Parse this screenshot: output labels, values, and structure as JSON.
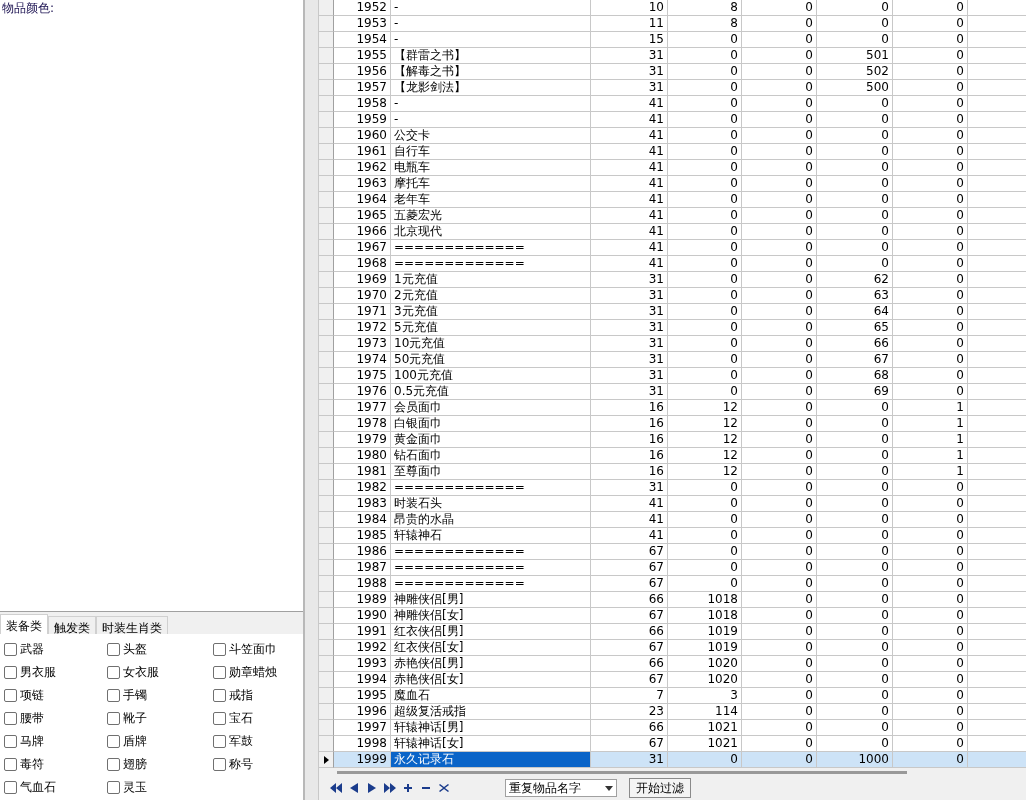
{
  "left_panel": {
    "color_label": "物品颜色:",
    "tabs": [
      {
        "label": "装备类",
        "selected": true
      },
      {
        "label": "触发类",
        "selected": false
      },
      {
        "label": "时装生肖类",
        "selected": false
      }
    ],
    "checkboxes": [
      {
        "label": "武器",
        "checked": false
      },
      {
        "label": "头盔",
        "checked": false
      },
      {
        "label": "斗笠面巾",
        "checked": false
      },
      {
        "label": "男衣服",
        "checked": false
      },
      {
        "label": "女衣服",
        "checked": false
      },
      {
        "label": "勋章蜡烛",
        "checked": false
      },
      {
        "label": "项链",
        "checked": false
      },
      {
        "label": "手镯",
        "checked": false
      },
      {
        "label": "戒指",
        "checked": false
      },
      {
        "label": "腰带",
        "checked": false
      },
      {
        "label": "靴子",
        "checked": false
      },
      {
        "label": "宝石",
        "checked": false
      },
      {
        "label": "马牌",
        "checked": false
      },
      {
        "label": "盾牌",
        "checked": false
      },
      {
        "label": "军鼓",
        "checked": false
      },
      {
        "label": "毒符",
        "checked": false
      },
      {
        "label": "翅膀",
        "checked": false
      },
      {
        "label": "称号",
        "checked": false
      },
      {
        "label": "气血石",
        "checked": false
      },
      {
        "label": "灵玉",
        "checked": false
      }
    ]
  },
  "table": {
    "rows": [
      {
        "cells": [
          "1952",
          "-",
          "10",
          "8",
          "0",
          "0",
          "0"
        ],
        "selected": false
      },
      {
        "cells": [
          "1953",
          "-",
          "11",
          "8",
          "0",
          "0",
          "0"
        ],
        "selected": false
      },
      {
        "cells": [
          "1954",
          "-",
          "15",
          "0",
          "0",
          "0",
          "0"
        ],
        "selected": false
      },
      {
        "cells": [
          "1955",
          "【群雷之书】",
          "31",
          "0",
          "0",
          "501",
          "0"
        ],
        "selected": false
      },
      {
        "cells": [
          "1956",
          "【解毒之书】",
          "31",
          "0",
          "0",
          "502",
          "0"
        ],
        "selected": false
      },
      {
        "cells": [
          "1957",
          "【龙影剑法】",
          "31",
          "0",
          "0",
          "500",
          "0"
        ],
        "selected": false
      },
      {
        "cells": [
          "1958",
          "-",
          "41",
          "0",
          "0",
          "0",
          "0"
        ],
        "selected": false
      },
      {
        "cells": [
          "1959",
          "-",
          "41",
          "0",
          "0",
          "0",
          "0"
        ],
        "selected": false
      },
      {
        "cells": [
          "1960",
          "公交卡",
          "41",
          "0",
          "0",
          "0",
          "0"
        ],
        "selected": false
      },
      {
        "cells": [
          "1961",
          "自行车",
          "41",
          "0",
          "0",
          "0",
          "0"
        ],
        "selected": false
      },
      {
        "cells": [
          "1962",
          "电瓶车",
          "41",
          "0",
          "0",
          "0",
          "0"
        ],
        "selected": false
      },
      {
        "cells": [
          "1963",
          "摩托车",
          "41",
          "0",
          "0",
          "0",
          "0"
        ],
        "selected": false
      },
      {
        "cells": [
          "1964",
          "老年车",
          "41",
          "0",
          "0",
          "0",
          "0"
        ],
        "selected": false
      },
      {
        "cells": [
          "1965",
          "五菱宏光",
          "41",
          "0",
          "0",
          "0",
          "0"
        ],
        "selected": false
      },
      {
        "cells": [
          "1966",
          "北京现代",
          "41",
          "0",
          "0",
          "0",
          "0"
        ],
        "selected": false
      },
      {
        "cells": [
          "1967",
          "=============",
          "41",
          "0",
          "0",
          "0",
          "0"
        ],
        "selected": false
      },
      {
        "cells": [
          "1968",
          "=============",
          "41",
          "0",
          "0",
          "0",
          "0"
        ],
        "selected": false
      },
      {
        "cells": [
          "1969",
          "1元充值",
          "31",
          "0",
          "0",
          "62",
          "0"
        ],
        "selected": false
      },
      {
        "cells": [
          "1970",
          "2元充值",
          "31",
          "0",
          "0",
          "63",
          "0"
        ],
        "selected": false
      },
      {
        "cells": [
          "1971",
          "3元充值",
          "31",
          "0",
          "0",
          "64",
          "0"
        ],
        "selected": false
      },
      {
        "cells": [
          "1972",
          "5元充值",
          "31",
          "0",
          "0",
          "65",
          "0"
        ],
        "selected": false
      },
      {
        "cells": [
          "1973",
          "10元充值",
          "31",
          "0",
          "0",
          "66",
          "0"
        ],
        "selected": false
      },
      {
        "cells": [
          "1974",
          "50元充值",
          "31",
          "0",
          "0",
          "67",
          "0"
        ],
        "selected": false
      },
      {
        "cells": [
          "1975",
          "100元充值",
          "31",
          "0",
          "0",
          "68",
          "0"
        ],
        "selected": false
      },
      {
        "cells": [
          "1976",
          "0.5元充值",
          "31",
          "0",
          "0",
          "69",
          "0"
        ],
        "selected": false
      },
      {
        "cells": [
          "1977",
          "会员面巾",
          "16",
          "12",
          "0",
          "0",
          "1"
        ],
        "selected": false
      },
      {
        "cells": [
          "1978",
          "白银面巾",
          "16",
          "12",
          "0",
          "0",
          "1"
        ],
        "selected": false
      },
      {
        "cells": [
          "1979",
          "黄金面巾",
          "16",
          "12",
          "0",
          "0",
          "1"
        ],
        "selected": false
      },
      {
        "cells": [
          "1980",
          "钻石面巾",
          "16",
          "12",
          "0",
          "0",
          "1"
        ],
        "selected": false
      },
      {
        "cells": [
          "1981",
          "至尊面巾",
          "16",
          "12",
          "0",
          "0",
          "1"
        ],
        "selected": false
      },
      {
        "cells": [
          "1982",
          "=============",
          "31",
          "0",
          "0",
          "0",
          "0"
        ],
        "selected": false
      },
      {
        "cells": [
          "1983",
          "时装石头",
          "41",
          "0",
          "0",
          "0",
          "0"
        ],
        "selected": false
      },
      {
        "cells": [
          "1984",
          "昂贵的水晶",
          "41",
          "0",
          "0",
          "0",
          "0"
        ],
        "selected": false
      },
      {
        "cells": [
          "1985",
          "轩辕神石",
          "41",
          "0",
          "0",
          "0",
          "0"
        ],
        "selected": false
      },
      {
        "cells": [
          "1986",
          "=============",
          "67",
          "0",
          "0",
          "0",
          "0"
        ],
        "selected": false
      },
      {
        "cells": [
          "1987",
          "=============",
          "67",
          "0",
          "0",
          "0",
          "0"
        ],
        "selected": false
      },
      {
        "cells": [
          "1988",
          "=============",
          "67",
          "0",
          "0",
          "0",
          "0"
        ],
        "selected": false
      },
      {
        "cells": [
          "1989",
          "神雕侠侣[男]",
          "66",
          "1018",
          "0",
          "0",
          "0"
        ],
        "selected": false
      },
      {
        "cells": [
          "1990",
          "神雕侠侣[女]",
          "67",
          "1018",
          "0",
          "0",
          "0"
        ],
        "selected": false
      },
      {
        "cells": [
          "1991",
          "红衣侠侣[男]",
          "66",
          "1019",
          "0",
          "0",
          "0"
        ],
        "selected": false
      },
      {
        "cells": [
          "1992",
          "红衣侠侣[女]",
          "67",
          "1019",
          "0",
          "0",
          "0"
        ],
        "selected": false
      },
      {
        "cells": [
          "1993",
          "赤艳侠侣[男]",
          "66",
          "1020",
          "0",
          "0",
          "0"
        ],
        "selected": false
      },
      {
        "cells": [
          "1994",
          "赤艳侠侣[女]",
          "67",
          "1020",
          "0",
          "0",
          "0"
        ],
        "selected": false
      },
      {
        "cells": [
          "1995",
          "魔血石",
          "7",
          "3",
          "0",
          "0",
          "0"
        ],
        "selected": false
      },
      {
        "cells": [
          "1996",
          "超级复活戒指",
          "23",
          "114",
          "0",
          "0",
          "0"
        ],
        "selected": false
      },
      {
        "cells": [
          "1997",
          "轩辕神话[男]",
          "66",
          "1021",
          "0",
          "0",
          "0"
        ],
        "selected": false
      },
      {
        "cells": [
          "1998",
          "轩辕神话[女]",
          "67",
          "1021",
          "0",
          "0",
          "0"
        ],
        "selected": false
      },
      {
        "cells": [
          "1999",
          "永久记录石",
          "31",
          "0",
          "0",
          "1000",
          "0"
        ],
        "selected": true
      }
    ]
  },
  "toolbar": {
    "filter_dropdown": "重复物品名字",
    "filter_button": "开始过滤"
  }
}
